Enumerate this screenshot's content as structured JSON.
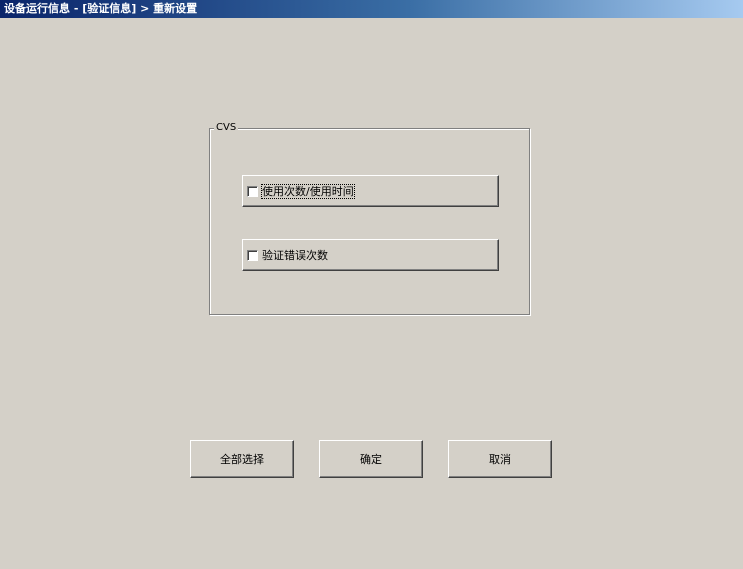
{
  "window": {
    "title": "设备运行信息 - [验证信息] > 重新设置"
  },
  "group": {
    "legend": "CVS",
    "options": [
      {
        "label": "使用次数/使用时间",
        "checked": false,
        "focused": true
      },
      {
        "label": "验证错误次数",
        "checked": false,
        "focused": false
      }
    ]
  },
  "buttons": {
    "select_all": "全部选择",
    "confirm": "确定",
    "cancel": "取消"
  },
  "colors": {
    "background": "#d4d0c8",
    "titlebar_start": "#0a246a",
    "titlebar_end": "#a6caf0"
  }
}
